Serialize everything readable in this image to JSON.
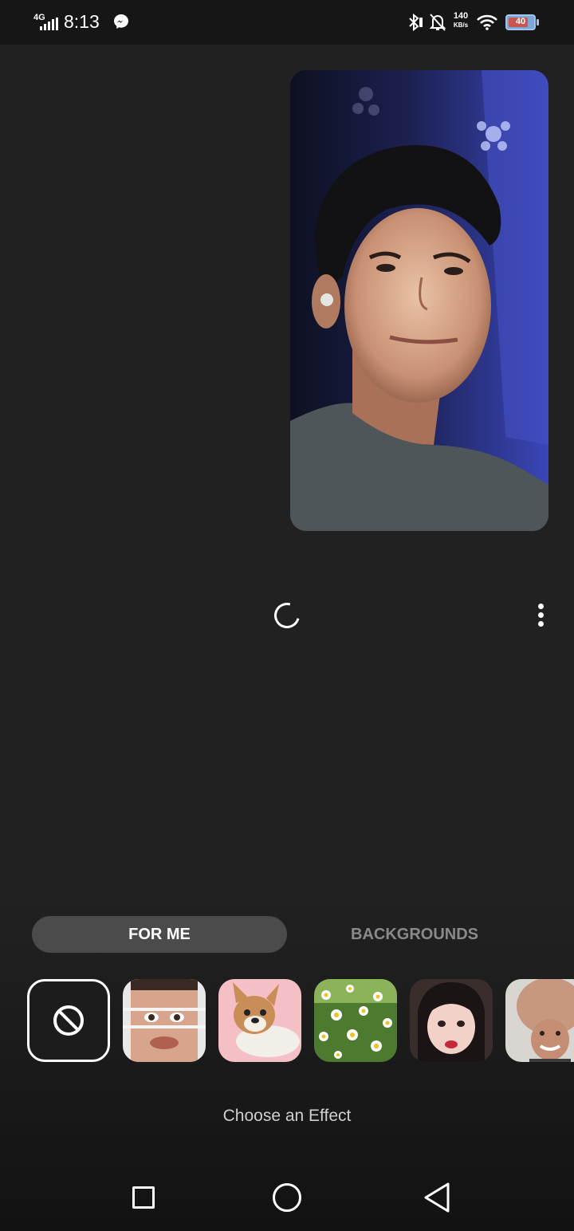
{
  "status_bar": {
    "network": "4G",
    "time": "8:13",
    "speed_value": "140",
    "speed_unit": "KB/s",
    "battery": "40"
  },
  "call": {
    "loading": true
  },
  "tabs": [
    {
      "label": "FOR ME",
      "selected": true
    },
    {
      "label": "BACKGROUNDS",
      "selected": false
    }
  ],
  "effects": [
    {
      "name": "no-effect-icon",
      "selected": true
    },
    {
      "name": "stretched-face-effect"
    },
    {
      "name": "dog-effect"
    },
    {
      "name": "daisy-field-effect"
    },
    {
      "name": "cartoon-face-effect"
    },
    {
      "name": "big-head-effect"
    }
  ],
  "footer": {
    "choose_label": "Choose an Effect"
  },
  "colors": {
    "background": "#212121",
    "tab_selected": "#4b4b4b",
    "tab_unselected_text": "#8a8a8a"
  }
}
